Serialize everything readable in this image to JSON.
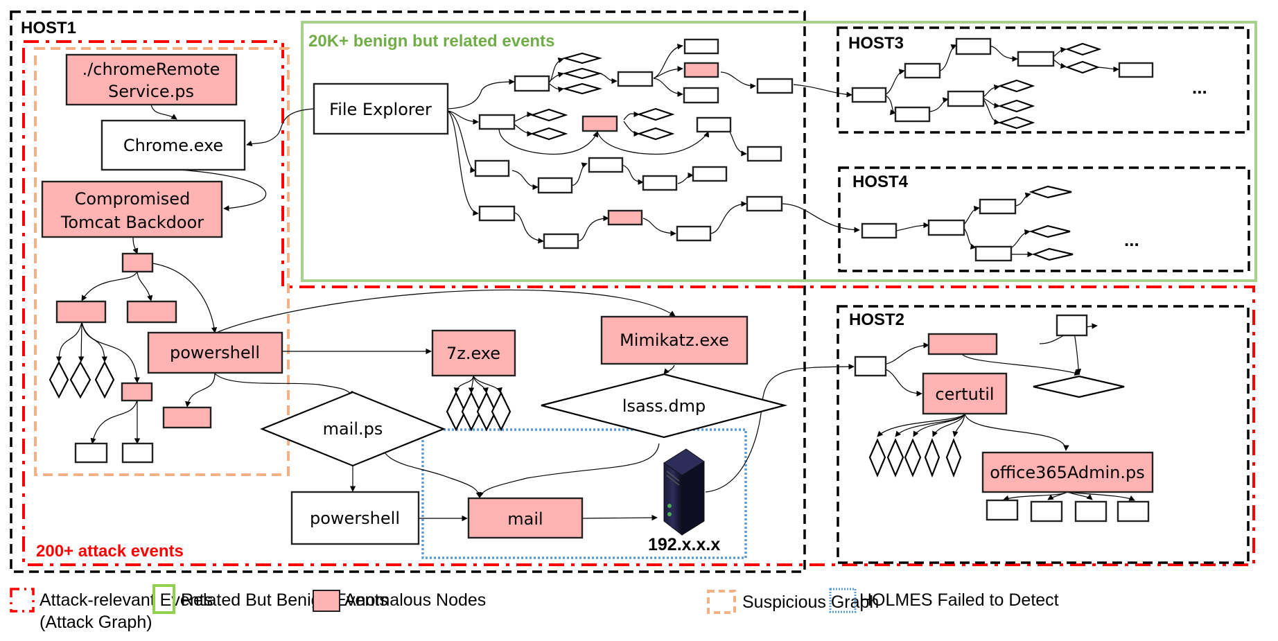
{
  "colors": {
    "anomalous_fill": "#ffb3b3",
    "attack_red": "#ff0000",
    "benign_green": "#a9d18e",
    "benign_text_green": "#70ad47",
    "suspicious_orange": "#f4b183",
    "holmes_blue": "#5b9bd5",
    "host_border": "#000000"
  },
  "hosts": {
    "host1": "HOST1",
    "host2": "HOST2",
    "host3": "HOST3",
    "host4": "HOST4"
  },
  "regions": {
    "benign_title": "20K+ benign but related events",
    "attack_title": "200+ attack events"
  },
  "nodes": {
    "chrome_remote": [
      "./chromeRemote",
      "Service.ps"
    ],
    "chrome_exe": "Chrome.exe",
    "tomcat": [
      "Compromised",
      "Tomcat Backdoor"
    ],
    "file_explorer": "File Explorer",
    "powershell1": "powershell",
    "powershell2": "powershell",
    "sevenz": "7z.exe",
    "mimikatz": "Mimikatz.exe",
    "lsass": "lsass.dmp",
    "mailps": "mail.ps",
    "mail": "mail",
    "server_ip": "192.x.x.x",
    "certutil": "certutil",
    "office365": "office365Admin.ps",
    "ellipsis": "..."
  },
  "legend": [
    {
      "key": "attack",
      "label": "Attack-relevant Events",
      "label2": "(Attack Graph)"
    },
    {
      "key": "benign",
      "label": "Related But Benign Events"
    },
    {
      "key": "anomalous",
      "label": "Anomalous Nodes"
    },
    {
      "key": "suspicious",
      "label": "Suspicious Graph"
    },
    {
      "key": "holmes",
      "label": "HOLMES Failed to Detect"
    }
  ]
}
